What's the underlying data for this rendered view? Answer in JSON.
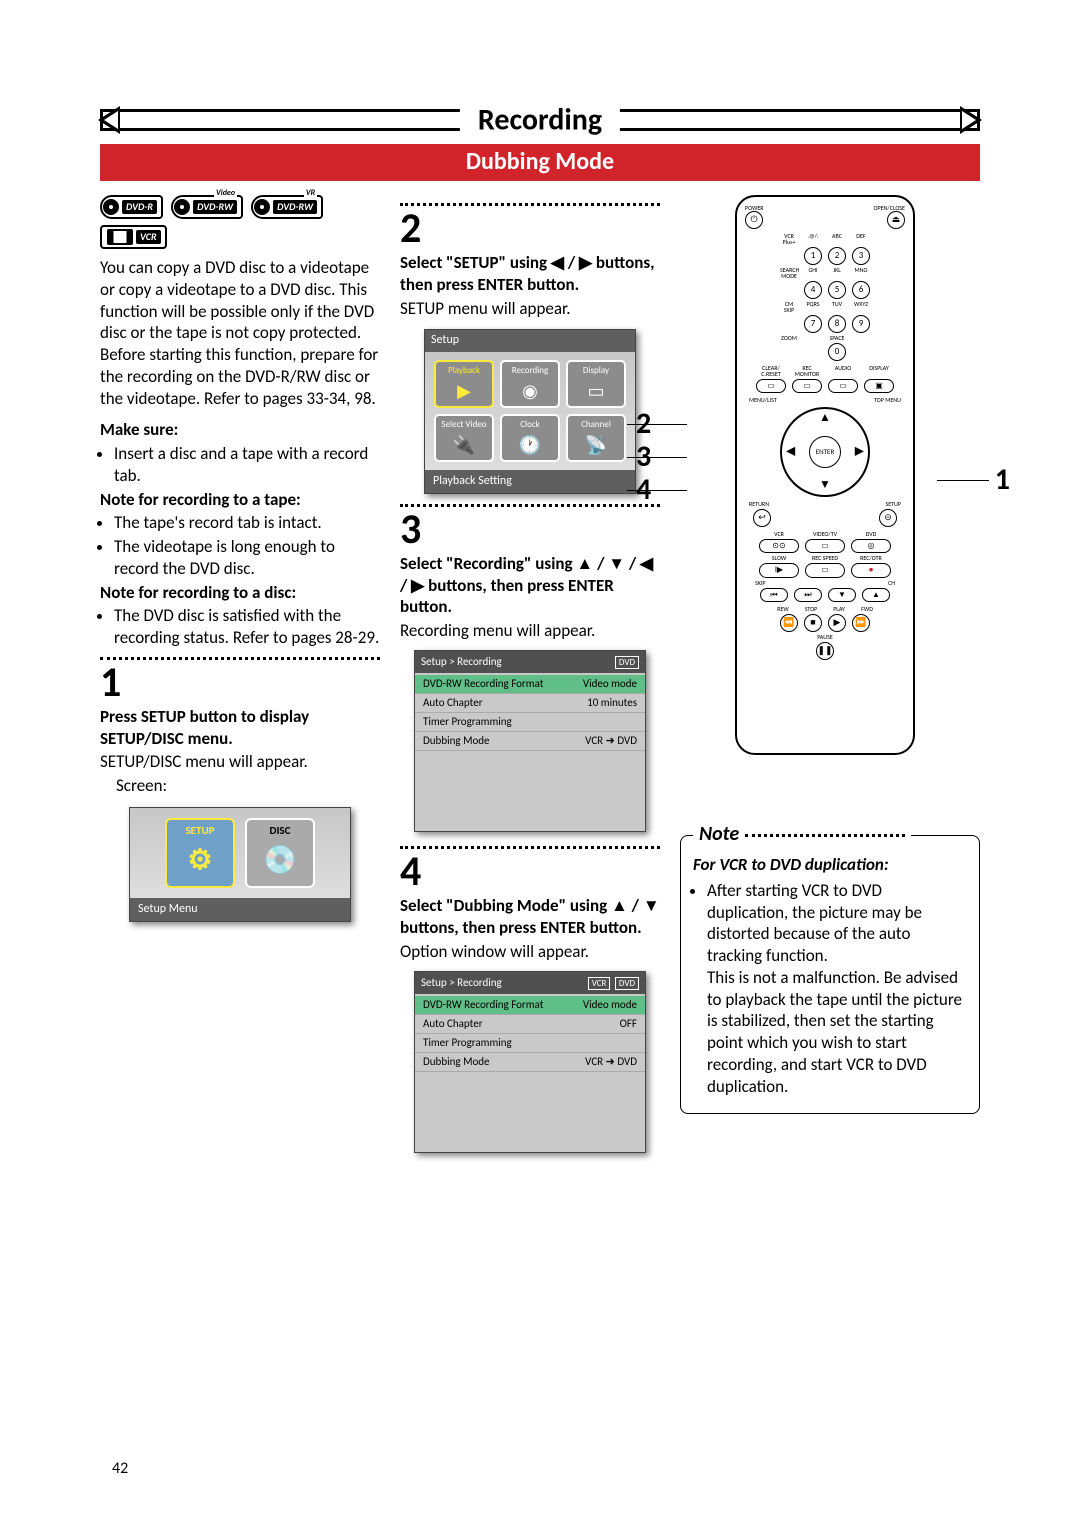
{
  "header": {
    "title": "Recording",
    "subtitle": "Dubbing Mode"
  },
  "badges": [
    "DVD-R",
    "DVD-RW",
    "DVD-RW",
    "VCR"
  ],
  "badge_sup": [
    "",
    "Video",
    "VR",
    ""
  ],
  "col1": {
    "intro": "You can copy a DVD disc to a videotape or copy a videotape to a DVD disc. This function will be possible only if the DVD disc or the tape is not copy protected. Before starting this function, prepare for the recording on the DVD-R/RW disc or the videotape. Refer to pages 33-34, 98.",
    "make_sure_h": "Make sure:",
    "make_sure_b1": "Insert a disc and a tape with a record tab.",
    "note_tape_h": "Note for recording to a tape:",
    "note_tape_b1": "The tape's record tab is intact.",
    "note_tape_b2": "The videotape is long enough to record the DVD disc.",
    "note_disc_h": "Note for recording to a disc:",
    "note_disc_b1": "The DVD disc is satisfied with the recording status. Refer to pages 28-29.",
    "step1_num": "1",
    "step1_h": "Press SETUP button to display SETUP/DISC menu.",
    "step1_p": "SETUP/DISC menu will appear.",
    "step1_p2": "Screen:",
    "osd_setup": "SETUP",
    "osd_disc": "DISC",
    "osd_caption": "Setup Menu"
  },
  "col2": {
    "step2_num": "2",
    "step2_h": "Select \"SETUP\" using ◀ / ▶ buttons, then press ENTER button.",
    "step2_p": "SETUP menu will appear.",
    "osd2_hdr": "Setup",
    "osd2_tiles": [
      "Playback",
      "Recording",
      "Display",
      "Select Video",
      "Clock",
      "Channel"
    ],
    "osd2_caption": "Playback Setting",
    "step3_num": "3",
    "step3_h": "Select \"Recording\" using ▲ / ▼ / ◀ / ▶ buttons, then press ENTER button.",
    "step3_p": "Recording menu will appear.",
    "osd3_hdr": "Setup > Recording",
    "osd3_tag": "DVD",
    "osd3_rows": [
      {
        "k": "DVD-RW Recording Format",
        "v": "Video mode"
      },
      {
        "k": "Auto Chapter",
        "v": "10 minutes"
      },
      {
        "k": "Timer Programming",
        "v": ""
      },
      {
        "k": "Dubbing Mode",
        "v": "VCR ➜ DVD"
      }
    ],
    "step4_num": "4",
    "step4_h": "Select \"Dubbing Mode\" using ▲ / ▼ buttons, then press ENTER button.",
    "step4_p": "Option window will appear.",
    "osd4_hdr": "Setup > Recording",
    "osd4_tags": [
      "VCR",
      "DVD"
    ],
    "osd4_rows": [
      {
        "k": "DVD-RW Recording Format",
        "v": "Video mode"
      },
      {
        "k": "Auto Chapter",
        "v": "OFF"
      },
      {
        "k": "Timer Programming",
        "v": ""
      },
      {
        "k": "Dubbing Mode",
        "v": "VCR ➜ DVD"
      }
    ]
  },
  "remote": {
    "callouts_left": [
      "2",
      "3",
      "4"
    ],
    "callout_right": "1",
    "top_left": "POWER",
    "top_right": "OPEN/CLOSE",
    "pad_sup": [
      "VCR Plus+",
      ".@/:",
      "ABC",
      "DEF",
      "SEARCH MODE",
      "GHI",
      "JKL",
      "MNO",
      "CM SKIP",
      "PQRS",
      "TUV",
      "WXYZ",
      "ZOOM",
      "",
      "SPACE",
      ""
    ],
    "pad": [
      "1",
      "2",
      "3",
      "4",
      "5",
      "6",
      "7",
      "8",
      "9",
      "0"
    ],
    "row_labels1": [
      "CLEAR/ C.RESET",
      "REC MONITOR",
      "AUDIO",
      "DISPLAY"
    ],
    "row_labels2": [
      "MENU/LIST",
      "",
      "",
      "TOP MENU"
    ],
    "enter": "ENTER",
    "row_labels3": [
      "RETURN",
      "SETUP"
    ],
    "row_labels4": [
      "VCR",
      "VIDEO/TV",
      "DVD"
    ],
    "row_labels5": [
      "SLOW",
      "REC SPEED",
      "REC/OTR"
    ],
    "row_labels6": [
      "SKIP",
      "CH"
    ],
    "row_labels7": [
      "REW",
      "STOP",
      "PLAY",
      "FWD"
    ],
    "pause": "PAUSE"
  },
  "note": {
    "hdr": "Note",
    "sub": "For VCR to DVD duplication:",
    "body": "After starting VCR to DVD duplication, the picture may be distorted because of the auto tracking function.\nThis is not a malfunction. Be advised to playback the tape until the picture is stabilized, then set the starting point which you wish to start recording, and start VCR to DVD duplication."
  },
  "page_number": "42"
}
